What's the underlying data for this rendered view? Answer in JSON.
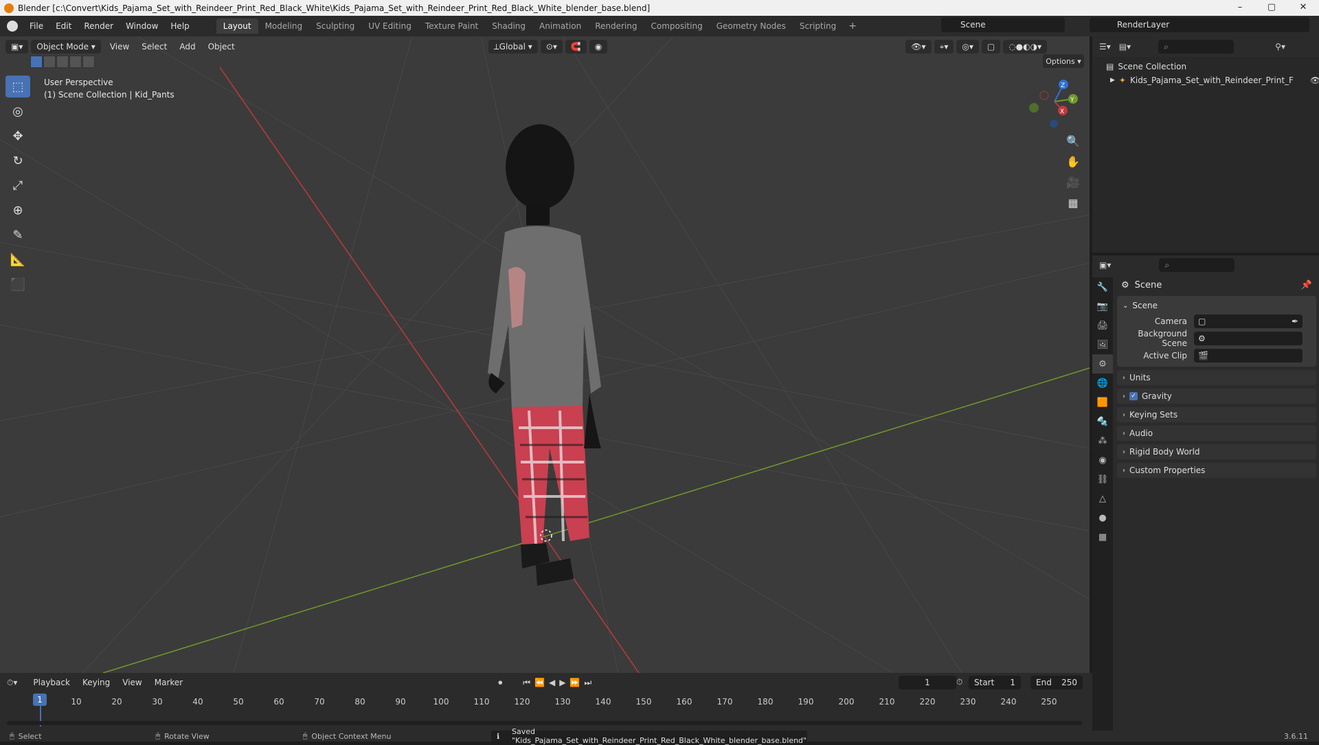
{
  "window": {
    "title": "Blender [c:\\Convert\\Kids_Pajama_Set_with_Reindeer_Print_Red_Black_White\\Kids_Pajama_Set_with_Reindeer_Print_Red_Black_White_blender_base.blend]",
    "controls": [
      "–",
      "▢",
      "✕"
    ]
  },
  "menu": [
    "File",
    "Edit",
    "Render",
    "Window",
    "Help"
  ],
  "workspaces": [
    "Layout",
    "Modeling",
    "Sculpting",
    "UV Editing",
    "Texture Paint",
    "Shading",
    "Animation",
    "Rendering",
    "Compositing",
    "Geometry Nodes",
    "Scripting"
  ],
  "active_workspace": "Layout",
  "scene_selector": "Scene",
  "render_layer": "RenderLayer",
  "viewport": {
    "mode": "Object Mode",
    "menus": [
      "View",
      "Select",
      "Add",
      "Object"
    ],
    "orientation": "Global",
    "options": "Options",
    "perspective": "User Perspective",
    "collection_info": "(1) Scene Collection | Kid_Pants",
    "gizmo_axes": [
      "X",
      "Y",
      "Z"
    ],
    "tools": [
      "select-box-icon",
      "cursor-icon",
      "move-icon",
      "rotate-icon",
      "scale-icon",
      "transform-icon",
      "annotate-icon",
      "measure-icon",
      "add-cube-icon"
    ]
  },
  "outliner": {
    "root": "Scene Collection",
    "items": [
      "Kids_Pajama_Set_with_Reindeer_Print_F"
    ]
  },
  "properties": {
    "header": "Scene",
    "panel": "Scene",
    "fields": [
      {
        "label": "Camera",
        "value": ""
      },
      {
        "label": "Background Scene",
        "value": ""
      },
      {
        "label": "Active Clip",
        "value": ""
      }
    ],
    "sections": [
      "Units",
      "Gravity",
      "Keying Sets",
      "Audio",
      "Rigid Body World",
      "Custom Properties"
    ],
    "gravity_checked": true
  },
  "timeline": {
    "menus": [
      "Playback",
      "Keying",
      "View",
      "Marker"
    ],
    "current_frame": "1",
    "start_label": "Start",
    "start": "1",
    "end_label": "End",
    "end": "250",
    "ticks": [
      "1",
      "10",
      "20",
      "30",
      "40",
      "50",
      "60",
      "70",
      "80",
      "90",
      "100",
      "110",
      "120",
      "130",
      "140",
      "150",
      "160",
      "170",
      "180",
      "190",
      "200",
      "210",
      "220",
      "230",
      "240",
      "250"
    ]
  },
  "statusbar": {
    "select": "Select",
    "rotate": "Rotate View",
    "context": "Object Context Menu",
    "message": "Saved \"Kids_Pajama_Set_with_Reindeer_Print_Red_Black_White_blender_base.blend\"",
    "version": "3.6.11"
  },
  "colors": {
    "accent": "#4772b3",
    "x_axis": "#c0393b",
    "y_axis": "#6f9a2a",
    "viewport_bg": "#3b3b3b"
  }
}
